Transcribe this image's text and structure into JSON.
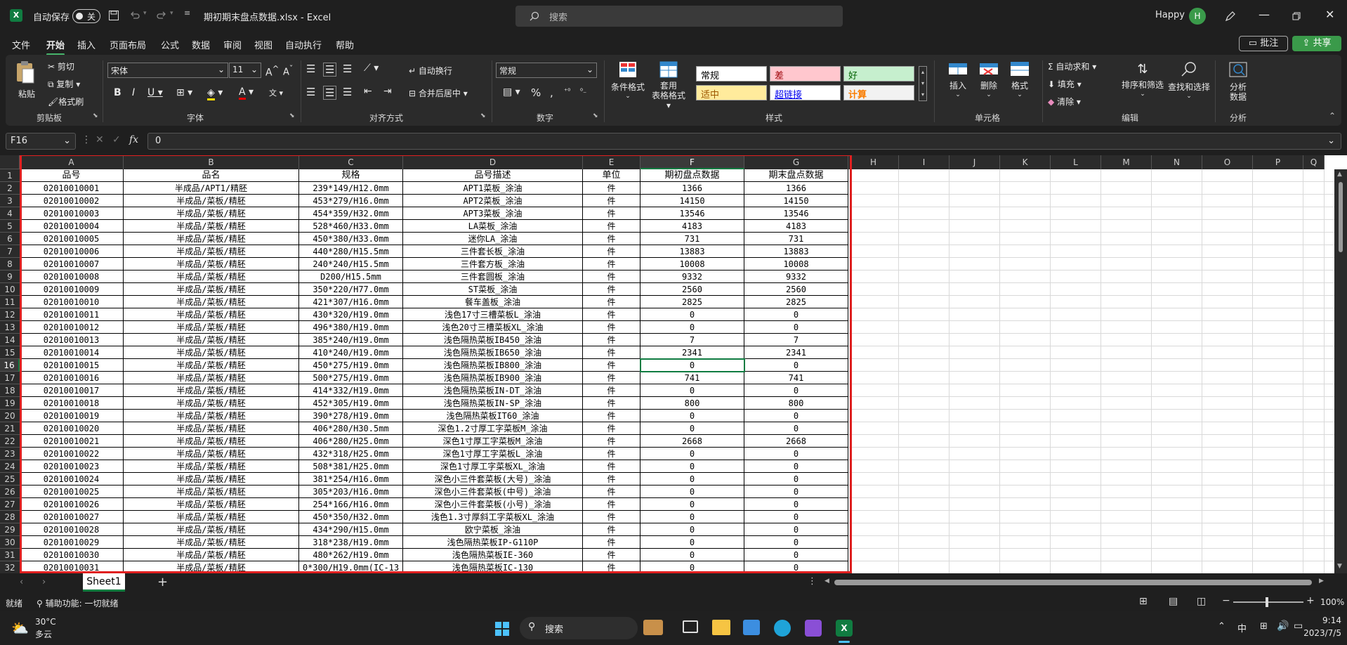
{
  "titlebar": {
    "autosave_label": "自动保存",
    "autosave_state": "关",
    "filename": "期初期末盘点数据.xlsx  -  Excel",
    "search_placeholder": "搜索",
    "user_name": "Happy",
    "user_initial": "H"
  },
  "menu": [
    "文件",
    "开始",
    "插入",
    "页面布局",
    "公式",
    "数据",
    "审阅",
    "视图",
    "自动执行",
    "帮助"
  ],
  "menu_active": 1,
  "menu_right": {
    "comments": "批注",
    "share": "共享"
  },
  "ribbon": {
    "clipboard": {
      "paste": "粘贴",
      "cut": "剪切",
      "copy": "复制",
      "format_painter": "格式刷",
      "label": "剪贴板"
    },
    "font": {
      "name": "宋体",
      "size": "11",
      "label": "字体"
    },
    "alignment": {
      "wrap": "自动换行",
      "merge": "合并后居中",
      "label": "对齐方式"
    },
    "number": {
      "format": "常规",
      "label": "数字"
    },
    "styles": {
      "conditional": "条件格式",
      "table_format_1": "套用",
      "table_format_2": "表格格式",
      "normal": "常规",
      "bad": "差",
      "good": "好",
      "neutral": "适中",
      "hyperlink": "超链接",
      "calc": "计算",
      "label": "样式"
    },
    "cells": {
      "insert": "插入",
      "delete": "删除",
      "format": "格式",
      "label": "单元格"
    },
    "editing": {
      "autosum": "自动求和",
      "fill": "填充",
      "clear": "清除",
      "sort_filter": "排序和筛选",
      "find_select": "查找和选择",
      "label": "编辑"
    },
    "analysis": {
      "analyze_1": "分析",
      "analyze_2": "数据",
      "label": "分析"
    }
  },
  "formula": {
    "name_box": "F16",
    "fx": "fx",
    "value": "0"
  },
  "columns": [
    "A",
    "B",
    "C",
    "D",
    "E",
    "F",
    "G",
    "H",
    "I",
    "J",
    "K",
    "L",
    "M",
    "N",
    "O",
    "P",
    "Q"
  ],
  "header_row": [
    "品号",
    "品名",
    "规格",
    "品号描述",
    "单位",
    "期初盘点数据",
    "期末盘点数据"
  ],
  "rows": [
    [
      "02010010001",
      "半成品/APT1/精胚",
      "239*149/H12.0mm",
      "APT1菜板_涂油",
      "件",
      "1366",
      "1366"
    ],
    [
      "02010010002",
      "半成品/菜板/精胚",
      "453*279/H16.0mm",
      "APT2菜板_涂油",
      "件",
      "14150",
      "14150"
    ],
    [
      "02010010003",
      "半成品/菜板/精胚",
      "454*359/H32.0mm",
      "APT3菜板_涂油",
      "件",
      "13546",
      "13546"
    ],
    [
      "02010010004",
      "半成品/菜板/精胚",
      "528*460/H33.0mm",
      "LA菜板_涂油",
      "件",
      "4183",
      "4183"
    ],
    [
      "02010010005",
      "半成品/菜板/精胚",
      "450*380/H33.0mm",
      "迷你LA_涂油",
      "件",
      "731",
      "731"
    ],
    [
      "02010010006",
      "半成品/菜板/精胚",
      "440*280/H15.5mm",
      "三件套长板_涂油",
      "件",
      "13883",
      "13883"
    ],
    [
      "02010010007",
      "半成品/菜板/精胚",
      "240*240/H15.5mm",
      "三件套方板_涂油",
      "件",
      "10008",
      "10008"
    ],
    [
      "02010010008",
      "半成品/菜板/精胚",
      "D200/H15.5mm",
      "三件套圆板_涂油",
      "件",
      "9332",
      "9332"
    ],
    [
      "02010010009",
      "半成品/菜板/精胚",
      "350*220/H77.0mm",
      "ST菜板_涂油",
      "件",
      "2560",
      "2560"
    ],
    [
      "02010010010",
      "半成品/菜板/精胚",
      "421*307/H16.0mm",
      "餐车盖板_涂油",
      "件",
      "2825",
      "2825"
    ],
    [
      "02010010011",
      "半成品/菜板/精胚",
      "430*320/H19.0mm",
      "浅色17寸三槽菜板L_涂油",
      "件",
      "0",
      "0"
    ],
    [
      "02010010012",
      "半成品/菜板/精胚",
      "496*380/H19.0mm",
      "浅色20寸三槽菜板XL_涂油",
      "件",
      "0",
      "0"
    ],
    [
      "02010010013",
      "半成品/菜板/精胚",
      "385*240/H19.0mm",
      "浅色隔热菜板IB450_涂油",
      "件",
      "7",
      "7"
    ],
    [
      "02010010014",
      "半成品/菜板/精胚",
      "410*240/H19.0mm",
      "浅色隔热菜板IB650_涂油",
      "件",
      "2341",
      "2341"
    ],
    [
      "02010010015",
      "半成品/菜板/精胚",
      "450*275/H19.0mm",
      "浅色隔热菜板IB800_涂油",
      "件",
      "0",
      "0"
    ],
    [
      "02010010016",
      "半成品/菜板/精胚",
      "500*275/H19.0mm",
      "浅色隔热菜板IB900_涂油",
      "件",
      "741",
      "741"
    ],
    [
      "02010010017",
      "半成品/菜板/精胚",
      "414*332/H19.0mm",
      "浅色隔热菜板IN-DT_涂油",
      "件",
      "0",
      "0"
    ],
    [
      "02010010018",
      "半成品/菜板/精胚",
      "452*305/H19.0mm",
      "浅色隔热菜板IN-SP_涂油",
      "件",
      "800",
      "800"
    ],
    [
      "02010010019",
      "半成品/菜板/精胚",
      "390*278/H19.0mm",
      "浅色隔热菜板IT60_涂油",
      "件",
      "0",
      "0"
    ],
    [
      "02010010020",
      "半成品/菜板/精胚",
      "406*280/H30.5mm",
      "深色1.2寸厚工字菜板M_涂油",
      "件",
      "0",
      "0"
    ],
    [
      "02010010021",
      "半成品/菜板/精胚",
      "406*280/H25.0mm",
      "深色1寸厚工字菜板M_涂油",
      "件",
      "2668",
      "2668"
    ],
    [
      "02010010022",
      "半成品/菜板/精胚",
      "432*318/H25.0mm",
      "深色1寸厚工字菜板L_涂油",
      "件",
      "0",
      "0"
    ],
    [
      "02010010023",
      "半成品/菜板/精胚",
      "508*381/H25.0mm",
      "深色1寸厚工字菜板XL_涂油",
      "件",
      "0",
      "0"
    ],
    [
      "02010010024",
      "半成品/菜板/精胚",
      "381*254/H16.0mm",
      "深色小三件套菜板(大号)_涂油",
      "件",
      "0",
      "0"
    ],
    [
      "02010010025",
      "半成品/菜板/精胚",
      "305*203/H16.0mm",
      "深色小三件套菜板(中号)_涂油",
      "件",
      "0",
      "0"
    ],
    [
      "02010010026",
      "半成品/菜板/精胚",
      "254*166/H16.0mm",
      "深色小三件套菜板(小号)_涂油",
      "件",
      "0",
      "0"
    ],
    [
      "02010010027",
      "半成品/菜板/精胚",
      "450*350/H32.0mm",
      "浅色1.3寸厚斜工字菜板XL_涂油",
      "件",
      "0",
      "0"
    ],
    [
      "02010010028",
      "半成品/菜板/精胚",
      "434*290/H15.0mm",
      "欧宁菜板_涂油",
      "件",
      "0",
      "0"
    ],
    [
      "02010010029",
      "半成品/菜板/精胚",
      "318*238/H19.0mm",
      "浅色隔热菜板IP-G110P",
      "件",
      "0",
      "0"
    ],
    [
      "02010010030",
      "半成品/菜板/精胚",
      "480*262/H19.0mm",
      "浅色隔热菜板IE-360",
      "件",
      "0",
      "0"
    ],
    [
      "02010010031",
      "半成品/菜板/精胚",
      "0*300/H19.0mm(IC-13",
      "浅色隔热菜板IC-130",
      "件",
      "0",
      "0"
    ]
  ],
  "row_numbers": [
    "1",
    "2",
    "3",
    "4",
    "5",
    "6",
    "7",
    "8",
    "9",
    "10",
    "11",
    "12",
    "13",
    "14",
    "15",
    "16",
    "17",
    "18",
    "19",
    "20",
    "21",
    "22",
    "23",
    "24",
    "25",
    "26",
    "27",
    "28",
    "29",
    "30",
    "31",
    "32"
  ],
  "sheet_tab": "Sheet1",
  "status": {
    "ready": "就绪",
    "accessibility": "辅助功能: 一切就绪",
    "zoom": "100%"
  },
  "taskbar": {
    "temp": "30°C",
    "weather": "多云",
    "search": "搜索",
    "ime": "中",
    "time": "9:14",
    "date": "2023/7/5"
  },
  "colors": {
    "accent_green": "#46b36b",
    "selection_red": "#e02020",
    "excel_green": "#107c41"
  }
}
